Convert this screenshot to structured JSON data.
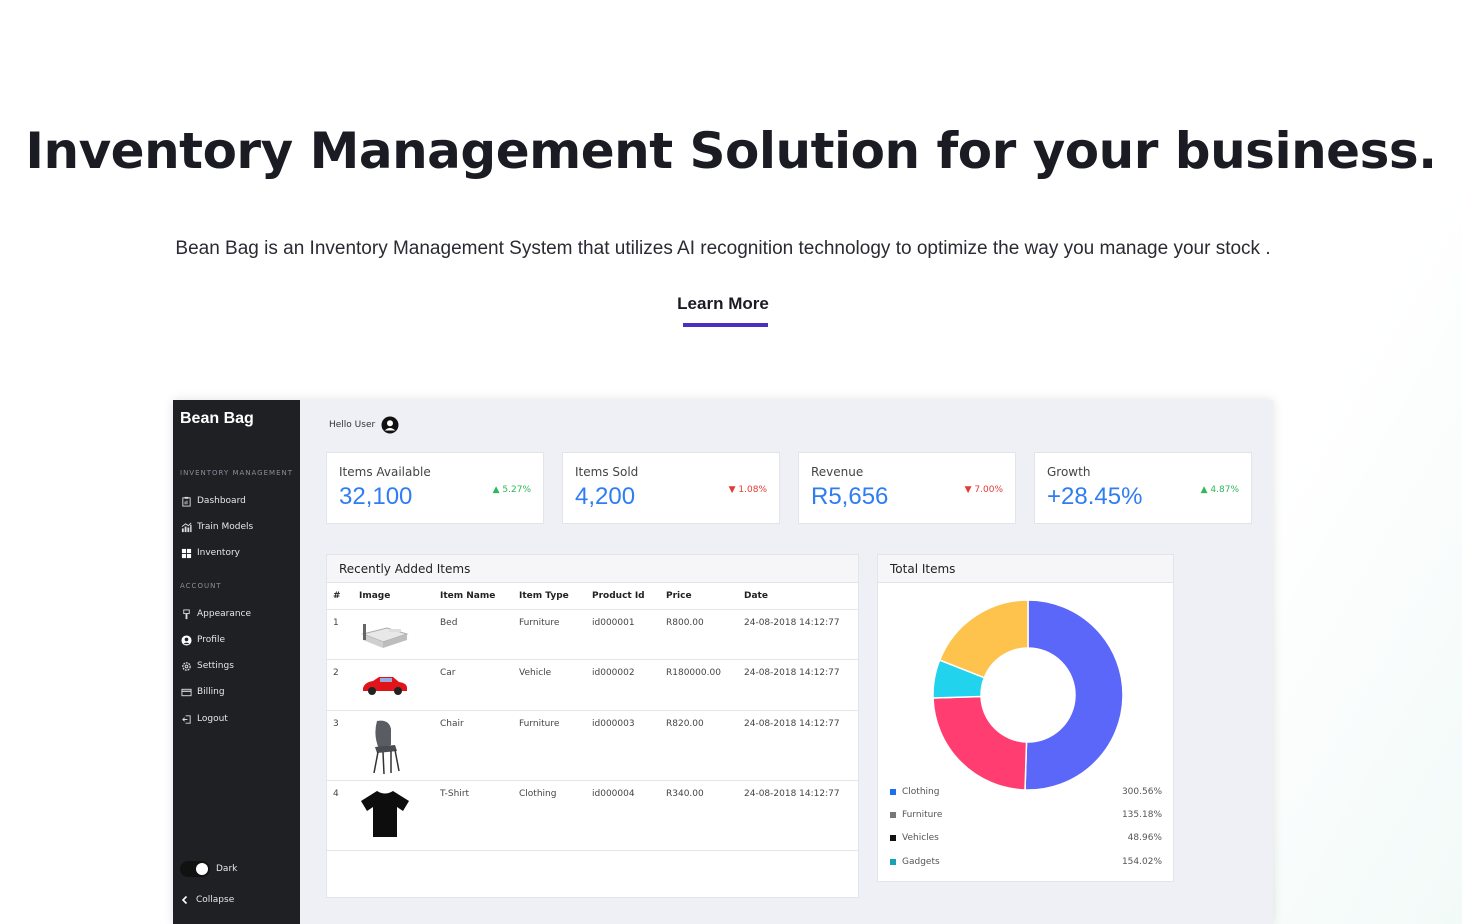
{
  "hero": {
    "title": "Inventory Management Solution for your business.",
    "subtitle": "Bean Bag is an Inventory Management System that utilizes AI recognition technology to optimize the way you manage your stock .",
    "cta": "Learn More"
  },
  "app": {
    "brand": "Bean Bag",
    "greeting": "Hello User",
    "sidebar": {
      "section_inventory": "INVENTORY MANAGEMENT",
      "section_account": "ACCOUNT",
      "items": [
        {
          "label": "Dashboard",
          "icon": "clipboard-icon"
        },
        {
          "label": "Train Models",
          "icon": "chart-icon"
        },
        {
          "label": "Inventory",
          "icon": "grid-icon"
        },
        {
          "label": "Appearance",
          "icon": "brush-icon"
        },
        {
          "label": "Profile",
          "icon": "user-icon"
        },
        {
          "label": "Settings",
          "icon": "gear-icon"
        },
        {
          "label": "Billing",
          "icon": "card-icon"
        },
        {
          "label": "Logout",
          "icon": "logout-icon"
        }
      ],
      "dark_label": "Dark",
      "collapse_label": "Collapse"
    },
    "stats": [
      {
        "label": "Items Available",
        "value": "32,100",
        "change": "5.27%",
        "direction": "up"
      },
      {
        "label": "Items Sold",
        "value": "4,200",
        "change": "1.08%",
        "direction": "down"
      },
      {
        "label": "Revenue",
        "value": "R5,656",
        "change": "7.00%",
        "direction": "down"
      },
      {
        "label": "Growth",
        "value": "+28.45%",
        "change": "4.87%",
        "direction": "up"
      }
    ],
    "recent": {
      "title": "Recently Added Items",
      "columns": [
        "#",
        "Image",
        "Item Name",
        "Item Type",
        "Product Id",
        "Price",
        "Date"
      ],
      "rows": [
        {
          "num": "1",
          "image": "bed",
          "name": "Bed",
          "type": "Furniture",
          "id": "id000001",
          "price": "R800.00",
          "date": "24-08-2018 14:12:77"
        },
        {
          "num": "2",
          "image": "car",
          "name": "Car",
          "type": "Vehicle",
          "id": "id000002",
          "price": "R180000.00",
          "date": "24-08-2018 14:12:77"
        },
        {
          "num": "3",
          "image": "chair",
          "name": "Chair",
          "type": "Furniture",
          "id": "id000003",
          "price": "R820.00",
          "date": "24-08-2018 14:12:77"
        },
        {
          "num": "4",
          "image": "tshirt",
          "name": "T-Shirt",
          "type": "Clothing",
          "id": "id000004",
          "price": "R340.00",
          "date": "24-08-2018 14:12:77"
        }
      ]
    },
    "total": {
      "title": "Total Items",
      "legend": [
        {
          "name": "Clothing",
          "value": "300.56%",
          "color": "#1e6ff0"
        },
        {
          "name": "Furniture",
          "value": "135.18%",
          "color": "#777777"
        },
        {
          "name": "Vehicles",
          "value": "48.96%",
          "color": "#111111"
        },
        {
          "name": "Gadgets",
          "value": "154.02%",
          "color": "#17a2b8"
        }
      ],
      "donut": [
        {
          "share": 0.505,
          "color": "#5b67f8"
        },
        {
          "share": 0.24,
          "color": "#ff3d71"
        },
        {
          "share": 0.065,
          "color": "#22d3ee"
        },
        {
          "share": 0.19,
          "color": "#fdc34d"
        }
      ]
    }
  }
}
